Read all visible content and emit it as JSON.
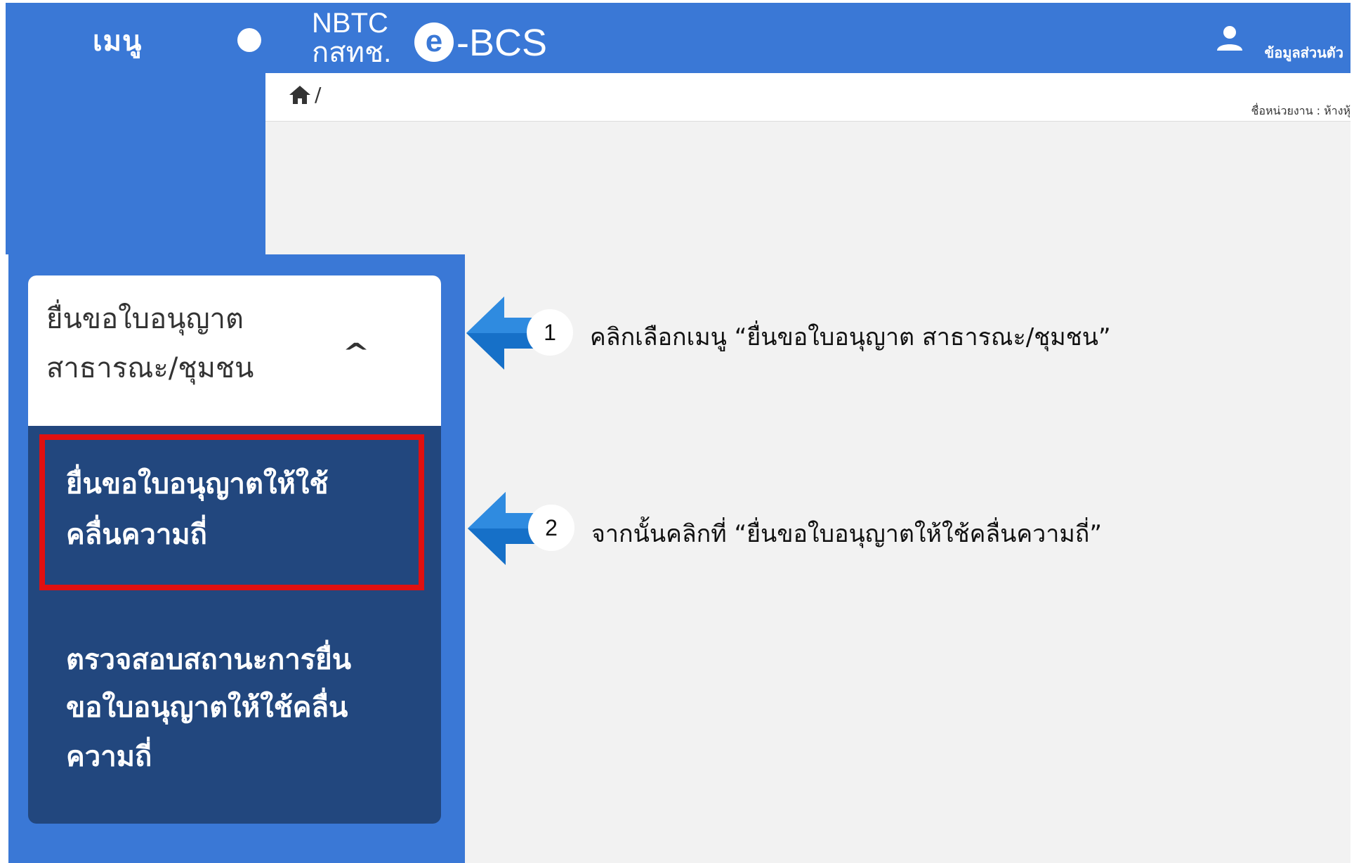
{
  "sidebar": {
    "menu_label": "เมนู"
  },
  "header": {
    "logo_line1": "NBTC",
    "logo_line2": "กสทช.",
    "logo_e": "e",
    "logo_bcs": "-BCS",
    "user_label": "ข้อมูลส่วนตัว"
  },
  "breadcrumb": {
    "separator": "/",
    "agency_label": "ชื่อหน่วยงาน : ห้างหุ้"
  },
  "menu": {
    "header_line1": "ยื่นขอใบอนุญาต",
    "header_line2": "สาธารณะ/ชุมชน",
    "chevron": "^",
    "item1_line1": "ยื่นขอใบอนุญาตให้ใช้",
    "item1_line2": "คลื่นความถี่",
    "item2_line1": "ตรวจสอบสถานะการยื่น",
    "item2_line2": "ขอใบอนุญาตให้ใช้คลื่น",
    "item2_line3": "ความถี่"
  },
  "annotations": {
    "step1_number": "1",
    "step1_text": "คลิกเลือกเมนู “ยื่นขอใบอนุญาต สาธารณะ/ชุมชน”",
    "step2_number": "2",
    "step2_text": "จากนั้นคลิกที่ “ยื่นขอใบอนุญาตให้ใช้คลื่นความถี่”"
  },
  "colors": {
    "brand_blue": "#3a78d6",
    "submenu_navy": "#22477e",
    "highlight_red": "#e01010",
    "arrow_blue": "#1670c8"
  }
}
